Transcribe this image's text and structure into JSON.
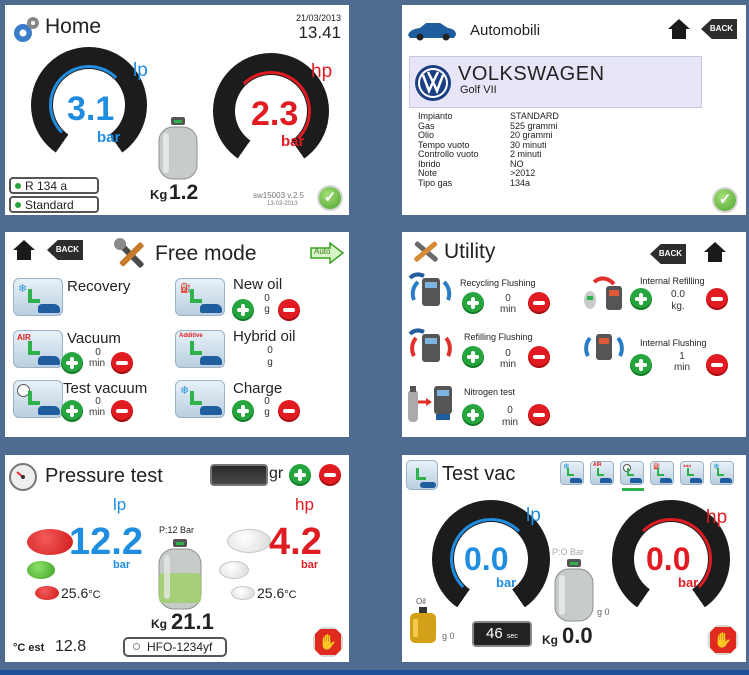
{
  "home": {
    "title": "Home",
    "date": "21/03/2013",
    "time": "13.41",
    "lp_label": "lp",
    "hp_label": "hp",
    "lp_value": "3.1",
    "hp_value": "2.3",
    "unit": "bar",
    "kg_label": "Kg",
    "kg_value": "1.2",
    "gas_type": "R 134 a",
    "mode": "Standard",
    "version": "sw15003 v.2.5",
    "version_date": "13-03-2013"
  },
  "auto": {
    "title": "Automobili",
    "brand": "VOLKSWAGEN",
    "model": "Golf VII",
    "back_label": "BACK",
    "rows": [
      {
        "k": "Impianto",
        "v": "STANDARD"
      },
      {
        "k": "Gas",
        "v": "525 grammi"
      },
      {
        "k": "Olio",
        "v": "20 grammi"
      },
      {
        "k": "Tempo vuoto",
        "v": "30 minuti"
      },
      {
        "k": "Controllo vuoto",
        "v": "2 minuti"
      },
      {
        "k": "Ibrido",
        "v": "NO"
      },
      {
        "k": "Note",
        "v": ">2012"
      },
      {
        "k": "Tipo gas",
        "v": "134a"
      }
    ]
  },
  "free": {
    "title": "Free mode",
    "back_label": "BACK",
    "auto_label": "Auto",
    "items": [
      {
        "label": "Recovery",
        "value": "",
        "unit": ""
      },
      {
        "label": "New oil",
        "value": "0",
        "unit": "g"
      },
      {
        "label": "Vacuum",
        "value": "0",
        "unit": "min"
      },
      {
        "label": "Hybrid oil",
        "value": "0",
        "unit": "g"
      },
      {
        "label": "Test vacuum",
        "value": "0",
        "unit": "min"
      },
      {
        "label": "Charge",
        "value": "0",
        "unit": "g"
      }
    ],
    "air_tag": "AIR",
    "additive_tag": "Additive"
  },
  "utility": {
    "title": "Utility",
    "back_label": "BACK",
    "items": [
      {
        "label": "Recycling Flushing",
        "value": "0",
        "unit": "min"
      },
      {
        "label": "Internal Refilling",
        "value": "0.0",
        "unit": "kg."
      },
      {
        "label": "Refilling Flushing",
        "value": "0",
        "unit": "min"
      },
      {
        "label": "Internal Flushing",
        "value": "1",
        "unit": "min"
      },
      {
        "label": "Nitrogen test",
        "value": "0",
        "unit": "min"
      }
    ]
  },
  "pressure": {
    "title": "Pressure test",
    "gr_label": "gr",
    "lp_label": "lp",
    "hp_label": "hp",
    "lp_value": "12.2",
    "hp_value": "4.2",
    "unit": "bar",
    "p_label": "P:12 Bar",
    "temp_left": "25.6",
    "temp_right": "25.6",
    "temp_unit": "°C",
    "kg_label": "Kg",
    "kg_value": "21.1",
    "est_label": "°C est",
    "est_value": "12.8",
    "gas_type": "HFO-1234yf"
  },
  "testvac": {
    "title": "Test vac",
    "lp_label": "lp",
    "hp_label": "hp",
    "lp_value": "0.0",
    "hp_value": "0.0",
    "unit": "bar",
    "p_label": "P:O Bar",
    "oil_label": "Oil",
    "g_left": "g 0",
    "g_right": "g 0",
    "timer_value": "46",
    "timer_unit": "sec",
    "kg_label": "Kg",
    "kg_value": "0.0"
  }
}
